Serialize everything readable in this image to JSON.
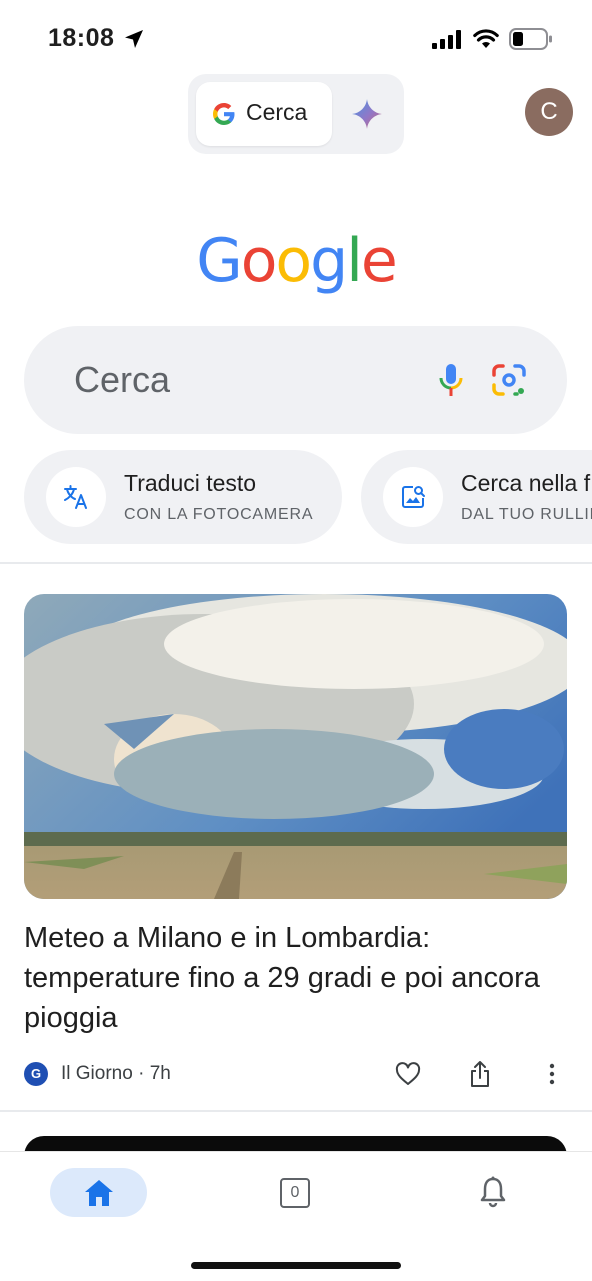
{
  "status_bar": {
    "time": "18:08",
    "icons": [
      "location-arrow-icon",
      "cellular-signal-icon",
      "wifi-icon",
      "battery-icon"
    ]
  },
  "mode_toggle": {
    "search_label": "Cerca",
    "icons": [
      "google-g-icon",
      "gemini-sparkle-icon"
    ]
  },
  "account": {
    "avatar_initial": "C"
  },
  "logo": {
    "text": "Google",
    "letters": [
      "G",
      "o",
      "o",
      "g",
      "l",
      "e"
    ],
    "colors": [
      "#4285F4",
      "#EA4335",
      "#FBBC05",
      "#4285F4",
      "#34A853",
      "#EA4335"
    ]
  },
  "search": {
    "placeholder": "Cerca",
    "icons": [
      "microphone-icon",
      "google-lens-icon"
    ]
  },
  "chips": [
    {
      "title": "Traduci testo",
      "subtitle": "CON LA FOTOCAMERA",
      "icon": "translate-icon"
    },
    {
      "title": "Cerca nella f",
      "subtitle": "DAL TUO RULLIN",
      "icon": "image-search-icon"
    }
  ],
  "feed": {
    "card": {
      "image": "storm-clouds-over-field-photo",
      "title": "Meteo a Milano e in Lombardia: temperature fino a 29 gradi e poi ancora pioggia",
      "source_initial": "G",
      "source": "Il Giorno · 7h",
      "actions": [
        "heart-icon",
        "share-icon",
        "more-vert-icon"
      ]
    }
  },
  "bottom_nav": {
    "tabs_count": "0",
    "items": [
      "home-icon",
      "tabs-icon",
      "bell-icon"
    ]
  },
  "colors": {
    "accent": "#1a73e8",
    "chip_bg": "#f0f1f4",
    "home_active_bg": "#dce9fb"
  }
}
